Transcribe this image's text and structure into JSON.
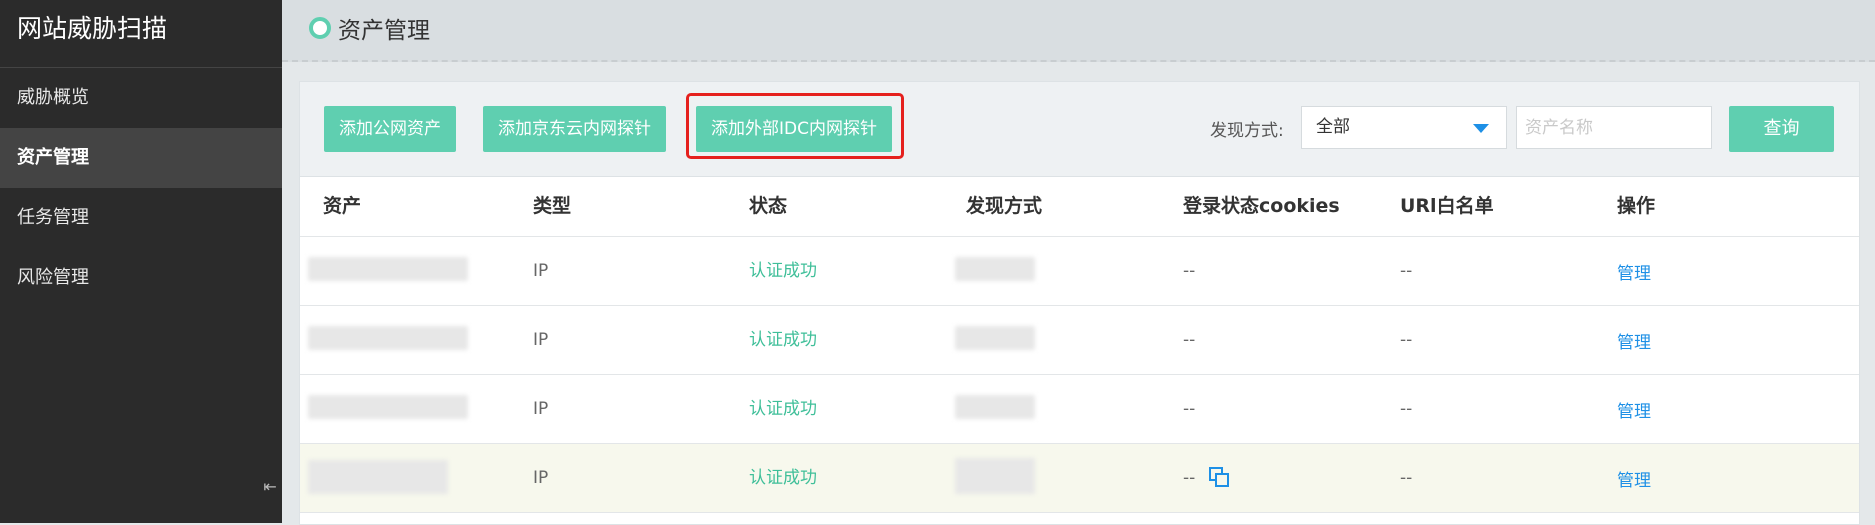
{
  "sidebar": {
    "app_title": "网站威胁扫描",
    "items": [
      {
        "label": "威胁概览",
        "active": false
      },
      {
        "label": "资产管理",
        "active": true
      },
      {
        "label": "任务管理",
        "active": false
      },
      {
        "label": "风险管理",
        "active": false
      }
    ],
    "collapse_icon": "collapse-left-icon"
  },
  "header": {
    "title": "资产管理"
  },
  "toolbar": {
    "add_public_asset": "添加公网资产",
    "add_jdcloud_probe": "添加京东云内网探针",
    "add_external_idc_probe": "添加外部IDC内网探针",
    "filter_label": "发现方式:",
    "filter_value": "全部",
    "search_placeholder": "资产名称",
    "query_label": "查询"
  },
  "colors": {
    "accent": "#5fcfb0",
    "link": "#1e90e6",
    "highlight_frame": "#e5201d",
    "status_success": "#3fbf99"
  },
  "table": {
    "columns": [
      "资产",
      "类型",
      "状态",
      "发现方式",
      "登录状态cookies",
      "URl白名单",
      "操作"
    ],
    "rows": [
      {
        "type": "IP",
        "status": "认证成功",
        "cookies": "--",
        "whitelist": "--",
        "action": "管理"
      },
      {
        "type": "IP",
        "status": "认证成功",
        "cookies": "--",
        "whitelist": "--",
        "action": "管理"
      },
      {
        "type": "IP",
        "status": "认证成功",
        "cookies": "--",
        "whitelist": "--",
        "action": "管理"
      },
      {
        "type": "IP",
        "status": "认证成功",
        "cookies": "--",
        "whitelist": "--",
        "action": "管理"
      }
    ]
  }
}
